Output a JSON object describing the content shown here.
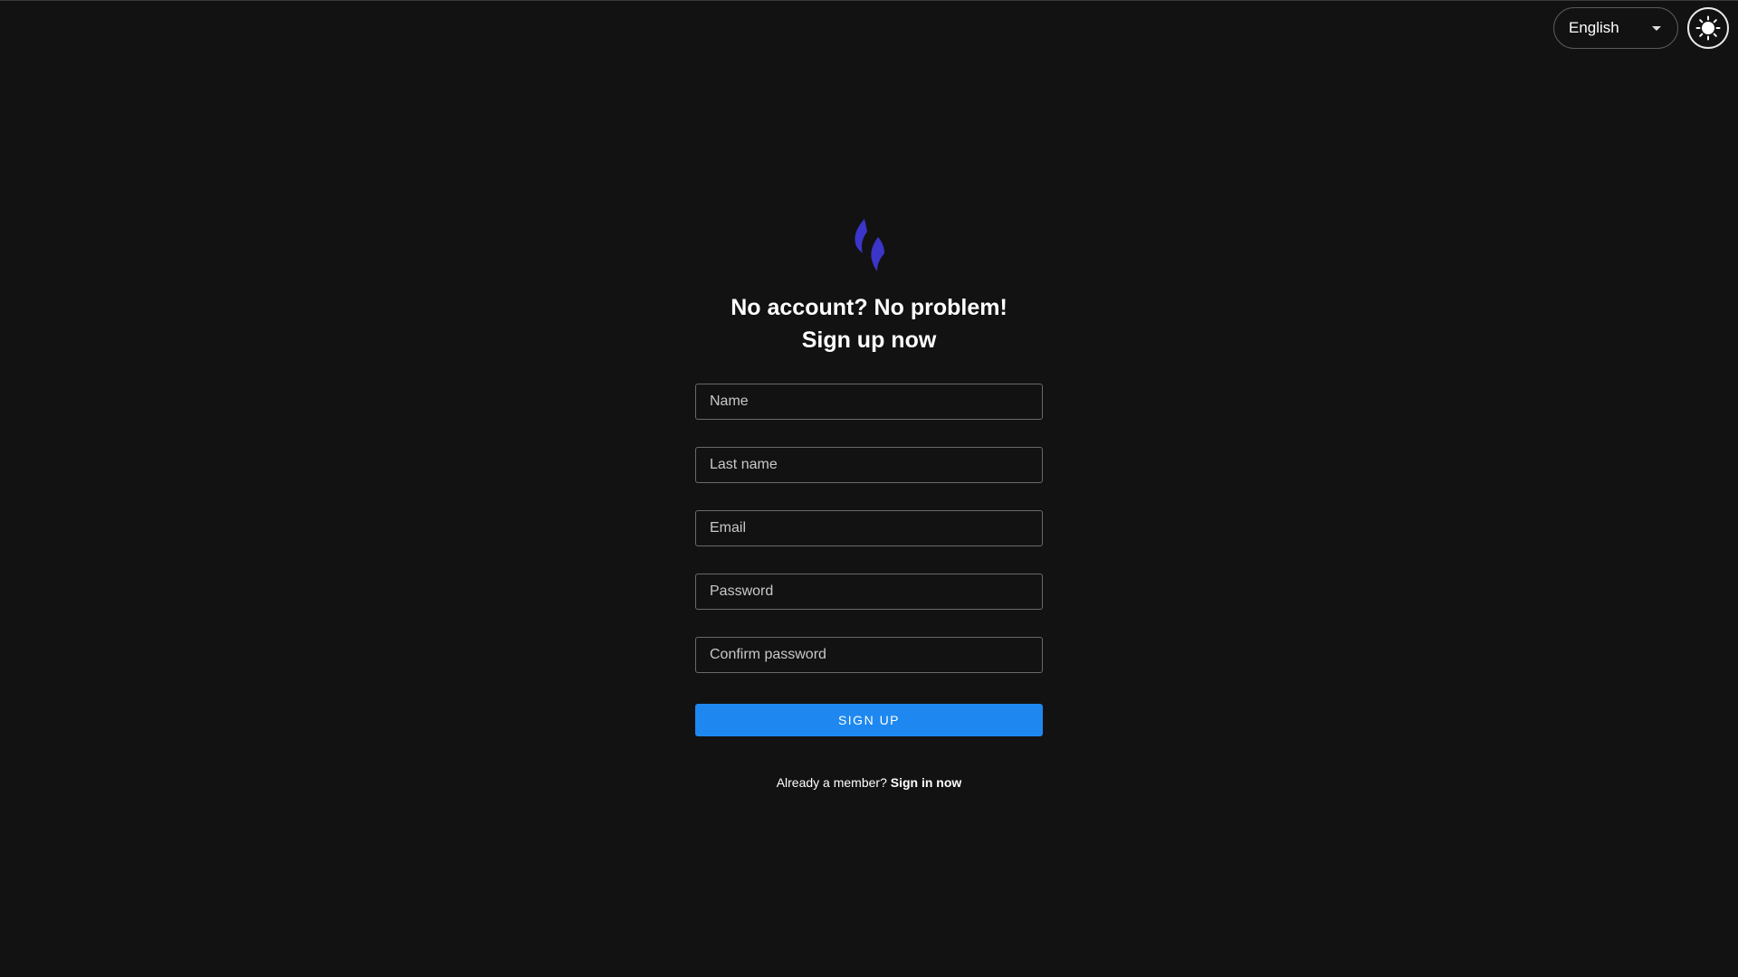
{
  "header": {
    "language": "English",
    "language_icon": "chevron-down-icon",
    "theme_icon": "sun-icon"
  },
  "logo": {
    "icon": "flame-logo",
    "color": "#3b35c9"
  },
  "heading": {
    "line1": "No account? No problem!",
    "line2": "Sign up now"
  },
  "form": {
    "name_placeholder": "Name",
    "last_name_placeholder": "Last name",
    "email_placeholder": "Email",
    "password_placeholder": "Password",
    "confirm_password_placeholder": "Confirm password",
    "submit_label": "SIGN UP",
    "accent_color": "#1e88f0"
  },
  "footer": {
    "member_text": "Already a member?",
    "signin_link": "Sign in now"
  }
}
